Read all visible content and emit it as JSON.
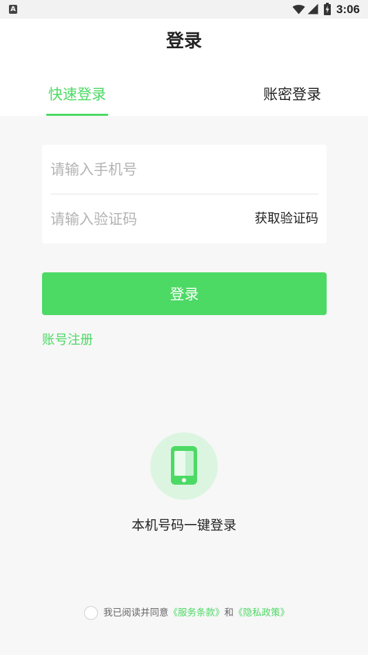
{
  "status_bar": {
    "notification_glyph": "A",
    "notification_icon": "a-icon",
    "wifi_icon": "wifi-icon",
    "signal_icon": "signal-icon",
    "battery_icon": "battery-charging-icon",
    "time": "3:06"
  },
  "header": {
    "title": "登录"
  },
  "tabs": [
    {
      "label": "快速登录",
      "active": true
    },
    {
      "label": "账密登录",
      "active": false
    }
  ],
  "form": {
    "phone": {
      "value": "",
      "placeholder": "请输入手机号"
    },
    "code": {
      "value": "",
      "placeholder": "请输入验证码"
    },
    "get_code_label": "获取验证码"
  },
  "login_button": {
    "label": "登录"
  },
  "register_link": {
    "label": "账号注册"
  },
  "one_click_login": {
    "icon": "phone-icon",
    "label": "本机号码一键登录"
  },
  "agreement": {
    "checked": false,
    "prefix": "我已阅读并同意",
    "terms_link": "《服务条款》",
    "conjunction": "和",
    "privacy_link": "《隐私政策》"
  },
  "colors": {
    "accent": "#4cd964",
    "icon_circle": "#dcf5e1",
    "page_background": "#f7f7f7",
    "placeholder": "#b3b3b3"
  }
}
